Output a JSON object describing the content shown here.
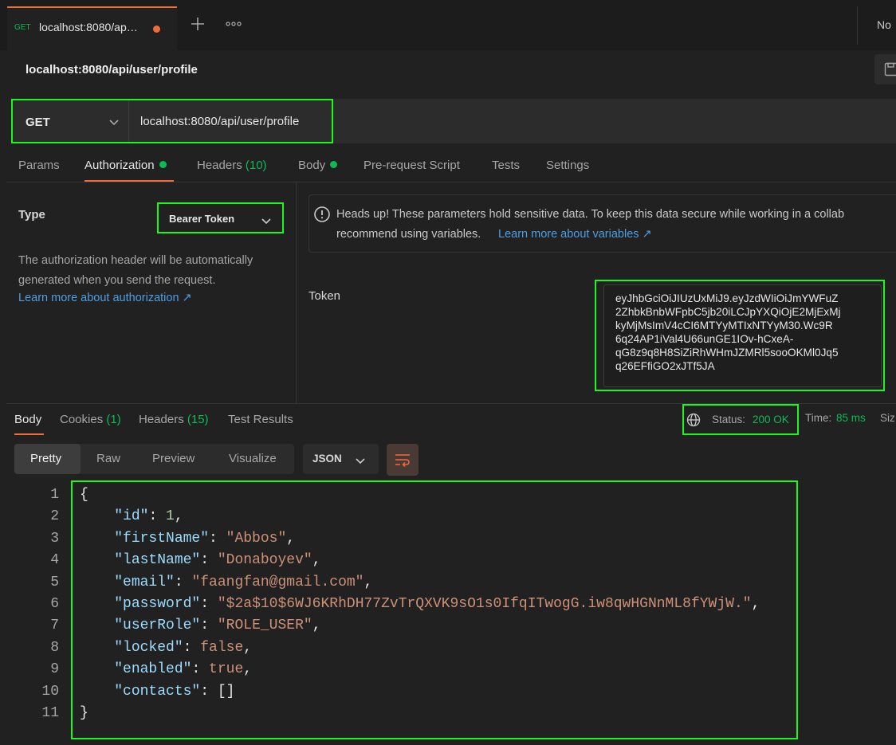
{
  "request_tab": {
    "method": "GET",
    "title": "localhost:8080/ap…"
  },
  "env_selector": {
    "label": "No"
  },
  "toolbar": {
    "add_icon": "plus-icon",
    "more_icon": "ellipsis-icon"
  },
  "request_name": "localhost:8080/api/user/profile",
  "url_bar": {
    "method": "GET",
    "url": "localhost:8080/api/user/profile"
  },
  "request_tabs": [
    {
      "label": "Params"
    },
    {
      "label": "Authorization"
    },
    {
      "label": "Headers",
      "count": "(10)"
    },
    {
      "label": "Body"
    },
    {
      "label": "Pre-request Script"
    },
    {
      "label": "Tests"
    },
    {
      "label": "Settings"
    }
  ],
  "auth": {
    "type_label": "Type",
    "type_value": "Bearer Token",
    "description": "The authorization header will be automatically generated when you send the request.",
    "learn_more": "Learn more about authorization ↗",
    "notice_line1": "Heads up! These parameters hold sensitive data. To keep this data secure while working in a collab",
    "notice_line2_text": "recommend using variables.",
    "notice_link": "Learn more about variables ↗",
    "token_label": "Token",
    "token_value": "eyJhbGciOiJIUzUxMiJ9.eyJzdWIiOiJmYWFuZ2ZhbkBnbWFpbC5jb20iLCJpYXQiOjE2MjExMjkyMjMsImV4cCI6MTYyMTIxNTYyM30.Wc9R6q24AP1iVal4U66unGE1IOv-hCxeA-qG8z9q8H8SiZiRhWHmJZMRl5sooOKMl0Jq5q26EFfiGO2xJTf5JA",
    "token_lines": [
      "eyJhbGciOiJIUzUxMiJ9.eyJzdWIiOiJmYWFuZ",
      "2ZhbkBnbWFpbC5jb20iLCJpYXQiOjE2MjExMj",
      "kyMjMsImV4cCI6MTYyMTIxNTYyM30.Wc9R",
      "6q24AP1iVal4U66unGE1IOv-hCxeA-",
      "qG8z9q8H8SiZiRhWHmJZMRl5sooOKMl0Jq5",
      "q26EFfiGO2xJTf5JA"
    ]
  },
  "response_tabs": [
    {
      "label": "Body"
    },
    {
      "label": "Cookies",
      "count": "(1)"
    },
    {
      "label": "Headers",
      "count": "(15)"
    },
    {
      "label": "Test Results"
    }
  ],
  "response_meta": {
    "status_label": "Status:",
    "status_value": "200 OK",
    "time_label": "Time:",
    "time_value": "85 ms",
    "size_label": "Siz"
  },
  "view_modes": [
    "Pretty",
    "Raw",
    "Preview",
    "Visualize"
  ],
  "format": "JSON",
  "code": {
    "line_numbers": [
      "1",
      "2",
      "3",
      "4",
      "5",
      "6",
      "7",
      "8",
      "9",
      "10",
      "11"
    ],
    "open_brace": "{",
    "close_brace": "}",
    "entries": [
      {
        "key": "\"id\"",
        "value": "1",
        "kind": "num"
      },
      {
        "key": "\"firstName\"",
        "value": "\"Abbos\"",
        "kind": "str"
      },
      {
        "key": "\"lastName\"",
        "value": "\"Donaboyev\"",
        "kind": "str"
      },
      {
        "key": "\"email\"",
        "value": "\"faangfan@gmail.com\"",
        "kind": "str"
      },
      {
        "key": "\"password\"",
        "value": "\"$2a$10$6WJ6KRhDH77ZvTrQXVK9sO1s0IfqITwogG.iw8qwHGNnML8fYWjW.\"",
        "kind": "str"
      },
      {
        "key": "\"userRole\"",
        "value": "\"ROLE_USER\"",
        "kind": "str"
      },
      {
        "key": "\"locked\"",
        "value": "false",
        "kind": "kw"
      },
      {
        "key": "\"enabled\"",
        "value": "true",
        "kind": "kw"
      },
      {
        "key": "\"contacts\"",
        "value": "[]",
        "kind": "pun"
      }
    ]
  }
}
